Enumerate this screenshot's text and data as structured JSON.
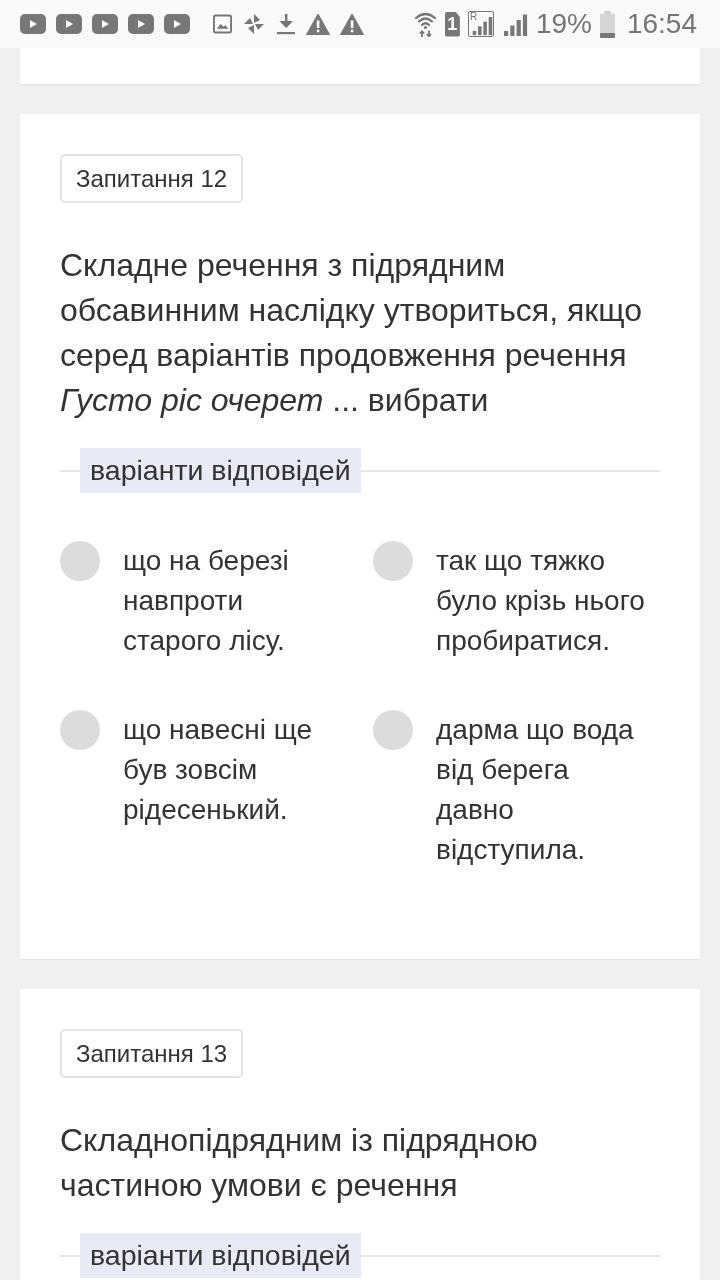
{
  "status_bar": {
    "sim_label": "1",
    "roaming_label": "R",
    "battery_percent": "19%",
    "time": "16:54"
  },
  "questions": [
    {
      "number_label": "Запитання 12",
      "text": "Складне речення з підрядним обсавинним наслідку утвориться, якщо серед варіантів продовження речення *Густо ріс очерет* ... вибрати",
      "options_label": "варіанти відповідей",
      "options": [
        {
          "text": "що на березі навпроти старого лісу.",
          "selected": false
        },
        {
          "text": "так що тяжко було крізь нього пробиратися.",
          "selected": false
        },
        {
          "text": "що навесні ще був зовсім рідесенький.",
          "selected": false
        },
        {
          "text": "дарма що вода від берега давно відступила.",
          "selected": false
        }
      ]
    },
    {
      "number_label": "Запитання 13",
      "text": "Складнопідрядним із підрядною частиною умови є речення",
      "options_label": "варіанти відповідей"
    }
  ]
}
